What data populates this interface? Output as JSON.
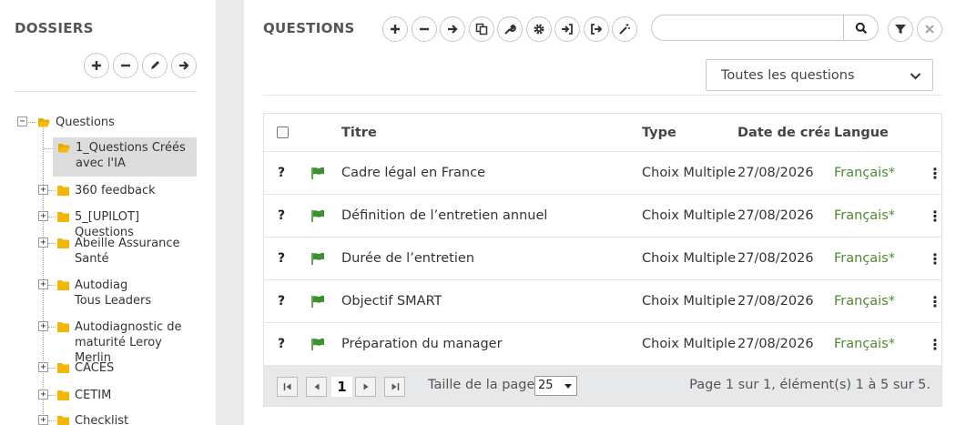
{
  "folders": {
    "title": "DOSSIERS",
    "toolbar": [
      "add-icon",
      "remove-icon",
      "edit-icon",
      "move-icon"
    ],
    "root": {
      "label": "Questions",
      "expander": "−"
    },
    "items": [
      {
        "label": "1_Questions Créés avec l'IA",
        "selected": true,
        "expandable": false
      },
      {
        "label": "360 feedback",
        "expandable": true
      },
      {
        "label": "5_[UPILOT] Questions",
        "expandable": true
      },
      {
        "label": "Abeille Assurance Santé",
        "expandable": true
      },
      {
        "label": "Autodiag Tous Leaders",
        "expandable": true
      },
      {
        "label": "Autodiagnostic de maturité Leroy Merlin",
        "expandable": true
      },
      {
        "label": "CACES",
        "expandable": true
      },
      {
        "label": "CETIM",
        "expandable": true
      },
      {
        "label": "Checklist",
        "expandable": true
      }
    ],
    "expander_plus": "+"
  },
  "questions": {
    "title": "QUESTIONS",
    "toolbar": [
      "add-icon",
      "remove-icon",
      "move-icon",
      "copy-icon",
      "wrench-icon",
      "gear-icon",
      "import-icon",
      "export-icon",
      "magic-wand-icon"
    ],
    "search": {
      "value": "",
      "placeholder": ""
    },
    "filter_select": {
      "selected": "Toutes les questions"
    },
    "columns": {
      "title": "Titre",
      "type": "Type",
      "date": "Date de créat",
      "lang": "Langue"
    },
    "rows": [
      {
        "status": "?",
        "title": "Cadre légal en France",
        "type": "Choix Multiple",
        "date": "27/08/2026",
        "lang": "Français*",
        "menu": "⋮"
      },
      {
        "status": "?",
        "title": "Définition de l’entretien annuel",
        "type": "Choix Multiple",
        "date": "27/08/2026",
        "lang": "Français*",
        "menu": "⋮"
      },
      {
        "status": "?",
        "title": "Durée de l’entretien",
        "type": "Choix Multiple",
        "date": "27/08/2026",
        "lang": "Français*",
        "menu": "⋮"
      },
      {
        "status": "?",
        "title": "Objectif SMART",
        "type": "Choix Multiple",
        "date": "27/08/2026",
        "lang": "Français*",
        "menu": "⋮"
      },
      {
        "status": "?",
        "title": "Préparation du manager",
        "type": "Choix Multiple",
        "date": "27/08/2026",
        "lang": "Français*",
        "menu": "⋮"
      }
    ],
    "pager": {
      "current_page": "1",
      "page_size_label": "Taille de la page:",
      "page_size": "25",
      "info": "Page 1 sur 1, élément(s) 1 à 5 sur 5."
    }
  },
  "colors": {
    "flag": "#3e9130",
    "lang": "#4c8a2e",
    "selected": "#dcdcdc",
    "folder": "#f2b705"
  }
}
